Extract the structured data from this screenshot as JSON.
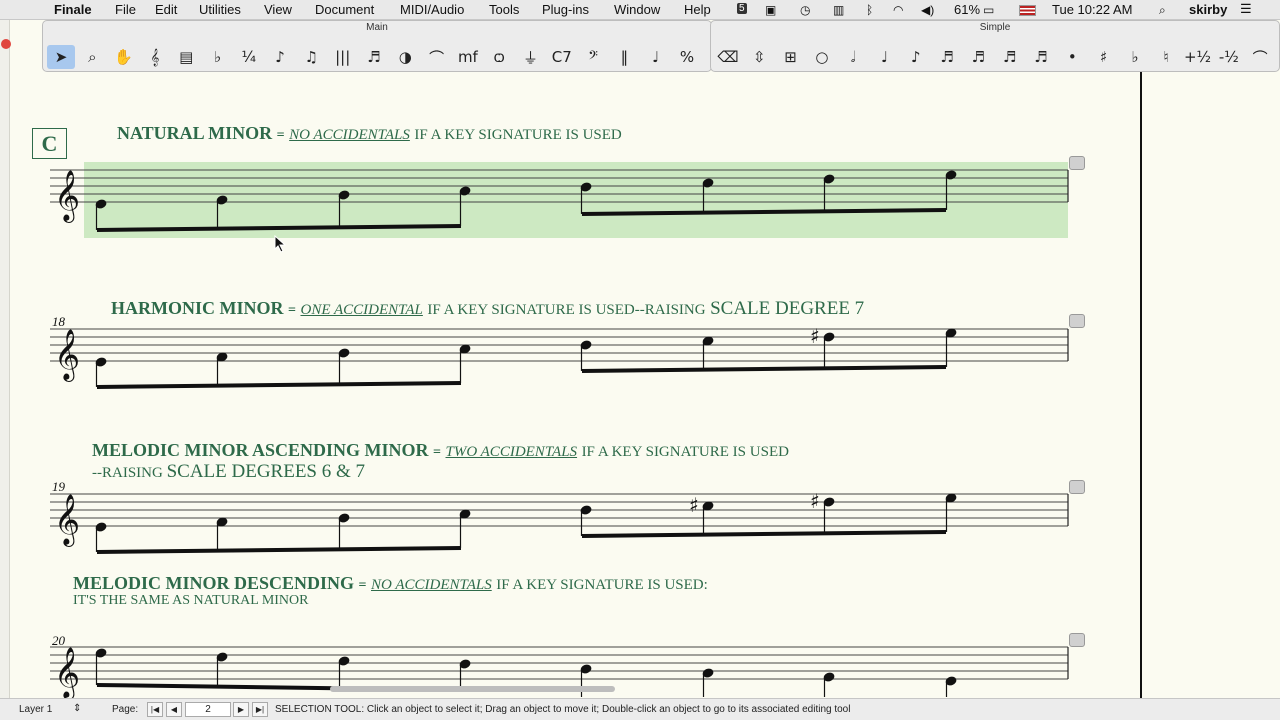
{
  "menubar": {
    "app_name": "Finale",
    "menus": [
      "File",
      "Edit",
      "Utilities",
      "View",
      "Document",
      "MIDI/Audio",
      "Tools",
      "Plug-ins",
      "Window",
      "Help"
    ],
    "battery": "61%",
    "clock": "Tue 10:22 AM",
    "user": "skirby"
  },
  "palettes": {
    "main_title": "Main",
    "simple_title": "Simple",
    "main_tools": [
      {
        "icon": "selection-arrow-icon",
        "glyph": "➤"
      },
      {
        "icon": "zoom-magnifier-icon",
        "glyph": "⌕"
      },
      {
        "icon": "hand-grabber-icon",
        "glyph": "✋"
      },
      {
        "icon": "staff-tool-icon",
        "glyph": "𝄞"
      },
      {
        "icon": "measure-tool-icon",
        "glyph": "▤"
      },
      {
        "icon": "key-signature-icon",
        "glyph": "♭"
      },
      {
        "icon": "time-signature-icon",
        "glyph": "¼"
      },
      {
        "icon": "simple-entry-icon",
        "glyph": "♪"
      },
      {
        "icon": "speedy-entry-icon",
        "glyph": "♫"
      },
      {
        "icon": "hyperscribe-icon",
        "glyph": "|||"
      },
      {
        "icon": "tuplet-icon",
        "glyph": "♬"
      },
      {
        "icon": "smart-shape-icon",
        "glyph": "◑"
      },
      {
        "icon": "slur-icon",
        "glyph": "⌒"
      },
      {
        "icon": "expression-icon",
        "glyph": "mf"
      },
      {
        "icon": "articulation-icon",
        "glyph": "ѻ"
      },
      {
        "icon": "mirror-tool-icon",
        "glyph": "⏚"
      },
      {
        "icon": "chord-tool-icon",
        "glyph": "C7"
      },
      {
        "icon": "clef-tool-icon",
        "glyph": "𝄢"
      },
      {
        "icon": "repeat-tool-icon",
        "glyph": "‖"
      },
      {
        "icon": "lyrics-tool-icon",
        "glyph": "♩"
      },
      {
        "icon": "percent-tool-icon",
        "glyph": "%"
      }
    ],
    "simple_tools": [
      {
        "icon": "eraser-icon",
        "glyph": "⌫"
      },
      {
        "icon": "updown-arrows-icon",
        "glyph": "⇳"
      },
      {
        "icon": "rest-tool-icon",
        "glyph": "⊞"
      },
      {
        "icon": "whole-note-icon",
        "glyph": "○"
      },
      {
        "icon": "half-note-icon",
        "glyph": "𝅗𝅥"
      },
      {
        "icon": "quarter-note-icon",
        "glyph": "♩"
      },
      {
        "icon": "eighth-note-icon",
        "glyph": "♪"
      },
      {
        "icon": "sixteenth-note-icon",
        "glyph": "♬"
      },
      {
        "icon": "thirty-second-note-icon",
        "glyph": "♬"
      },
      {
        "icon": "sixty-fourth-note-icon",
        "glyph": "♬"
      },
      {
        "icon": "128th-note-icon",
        "glyph": "♬"
      },
      {
        "icon": "dot-icon",
        "glyph": "•"
      },
      {
        "icon": "sharp-icon",
        "glyph": "♯"
      },
      {
        "icon": "flat-icon",
        "glyph": "♭"
      },
      {
        "icon": "natural-icon",
        "glyph": "♮"
      },
      {
        "icon": "half-step-up-icon",
        "glyph": "+½"
      },
      {
        "icon": "half-step-down-icon",
        "glyph": "-½"
      },
      {
        "icon": "tie-icon",
        "glyph": "⌒"
      }
    ]
  },
  "score": {
    "section_letter": "C",
    "systems": [
      {
        "title": "NATURAL MINOR",
        "eq": "=",
        "accidentals": "NO ACCIDENTALS",
        "rest": "IF  A KEY SIGNATURE IS USED",
        "measure": "",
        "sub": ""
      },
      {
        "title": "HARMONIC MINOR",
        "eq": "=",
        "accidentals": "ONE  ACCIDENTAL",
        "rest": "IF  A KEY SIGNATURE IS USED--RAISING",
        "big": "SCALE DEGREE 7",
        "measure": "18",
        "sub": ""
      },
      {
        "title": "MELODIC MINOR ASCENDING MINOR",
        "eq": "=",
        "accidentals": "TWO  ACCIDENTALS",
        "rest": "IF  A KEY SIGNATURE IS USED",
        "measure": "19",
        "sub": "--RAISING",
        "subbig": "SCALE DEGREES 6 & 7"
      },
      {
        "title": "MELODIC  MINOR DESCENDING",
        "eq": "=",
        "accidentals": "NO ACCIDENTALS",
        "rest": "IF  A KEY SIGNATURE IS USED:",
        "measure": "20",
        "sub": "IT'S THE SAME AS NATURAL MINOR"
      }
    ],
    "selection_color": "#cde9c2"
  },
  "status": {
    "layer": "Layer 1",
    "page_label": "Page:",
    "page_value": "2",
    "message": "SELECTION TOOL: Click an object to select it; Drag an object to move it; Double-click an object to go to its associated editing tool"
  }
}
